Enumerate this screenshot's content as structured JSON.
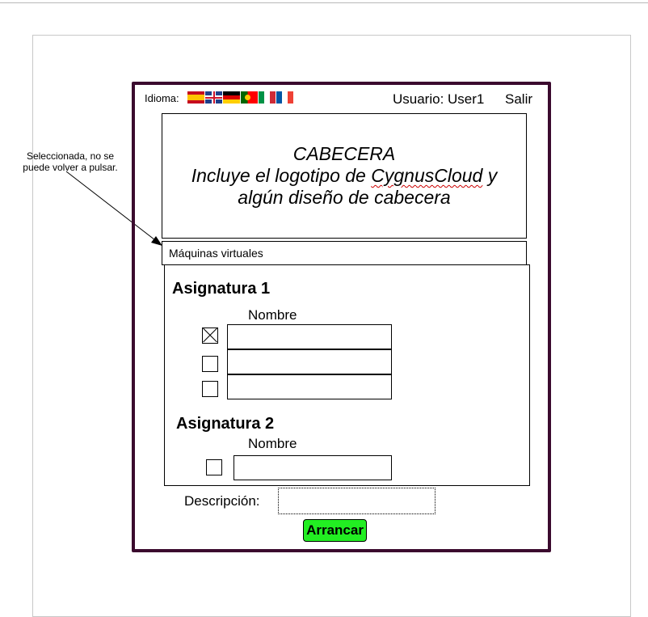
{
  "annotation": {
    "line1": "Seleccionada, no se",
    "line2": "puede volver a pulsar."
  },
  "topbar": {
    "language_label": "Idioma:",
    "languages": [
      "es",
      "en",
      "de",
      "pt",
      "it",
      "fr"
    ],
    "user_label": "Usuario: User1",
    "logout_label": "Salir"
  },
  "header": {
    "line1": "CABECERA",
    "line2_pre": "Incluye el logotipo de ",
    "line2_brand": "CygnusCloud",
    "line2_post": " y",
    "line3": "algún diseño de cabecera"
  },
  "tab": {
    "label": "Máquinas virtuales"
  },
  "subjects": [
    {
      "title": "Asignatura 1",
      "column_label": "Nombre",
      "rows": [
        {
          "checked": true
        },
        {
          "checked": false
        },
        {
          "checked": false
        }
      ]
    },
    {
      "title": "Asignatura 2",
      "column_label": "Nombre",
      "rows": [
        {
          "checked": false
        }
      ]
    }
  ],
  "form": {
    "description_label": "Descripción:",
    "description_value": "",
    "start_label": "Arrancar"
  },
  "colors": {
    "frame": "#3b0a2e",
    "start_button": "#22ee22"
  }
}
